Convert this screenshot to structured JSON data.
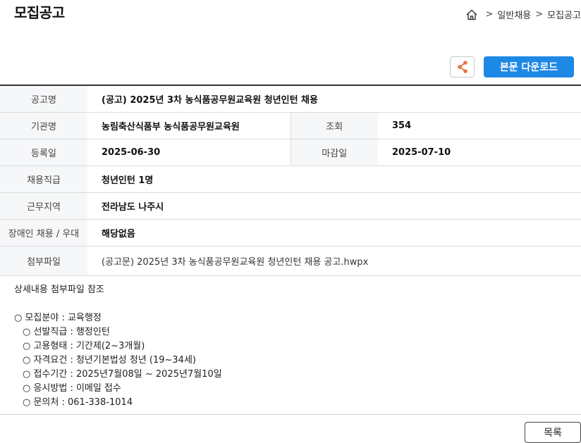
{
  "page_title": "모집공고",
  "breadcrumb": {
    "icon": "home-icon",
    "separator": ">",
    "items": [
      "일반채용",
      "모집공고"
    ]
  },
  "toolbar": {
    "share_icon": "share-icon",
    "download_label": "본문 다운로드"
  },
  "colors": {
    "primary": "#1e88e5",
    "share_accent": "#e8743b",
    "header_bg": "#f6f7f9"
  },
  "info": {
    "title": {
      "label": "공고명",
      "value": "(공고) 2025년 3차 농식품공무원교육원 청년인턴 채용"
    },
    "org": {
      "label": "기관명",
      "value": "농림축산식품부 농식품공무원교육원"
    },
    "views": {
      "label": "조회",
      "value": "354"
    },
    "reg_date": {
      "label": "등록일",
      "value": "2025-06-30"
    },
    "deadline": {
      "label": "마감일",
      "value": "2025-07-10"
    },
    "position": {
      "label": "채용직급",
      "value": "청년인턴 1명"
    },
    "location": {
      "label": "근무지역",
      "value": "전라남도 나주시"
    },
    "disability": {
      "label": "장애인 채용 / 우대",
      "value": "해당없음"
    },
    "attachment": {
      "label": "첨부파일",
      "value": "(공고문) 2025년 3차 농식품공무원교육원 청년인턴 채용 공고.hwpx"
    }
  },
  "details": {
    "intro": "상세내용 첨부파일 참조",
    "lines": [
      "○ 모집분야 : 교육행정",
      "○ 선발직급 : 행정인턴",
      "○ 고용형태 : 기간제(2~3개월)",
      "○ 자격요건 : 청년기본법성 청년 (19~34세)",
      "○ 접수기간 : 2025년7월08일 ~ 2025년7월10일",
      "○ 응시방법 : 이메일 접수",
      "○ 문의처 : 061-338-1014"
    ]
  },
  "footer": {
    "list_label": "목록"
  }
}
